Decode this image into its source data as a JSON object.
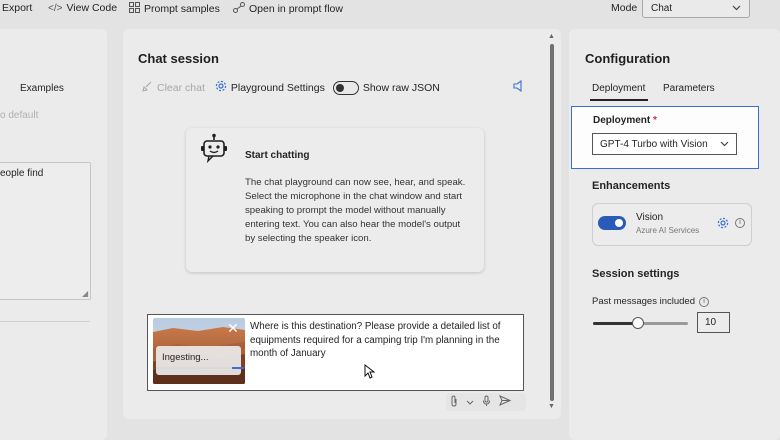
{
  "toolbar": {
    "export_label": "Export",
    "view_code_label": "View Code",
    "prompt_samples_label": "Prompt samples",
    "prompt_flow_label": "Open in prompt flow",
    "mode_label": "Mode",
    "mode_value": "Chat"
  },
  "left_panel": {
    "examples_label": "Examples",
    "default_text": "o default",
    "textarea_text": "eople find"
  },
  "chat": {
    "title": "Chat session",
    "clear_chat_label": "Clear chat",
    "playground_settings_label": "Playground Settings",
    "show_raw_json_label": "Show raw JSON",
    "start_title": "Start chatting",
    "start_body": "The chat playground can now see, hear, and speak. Select the microphone in the chat window and start speaking to prompt the model without manually entering text. You can also hear the model's output by selecting the speaker icon.",
    "ingesting_label": "Ingesting...",
    "prompt_text": "Where is this destination? Please provide a detailed list of equipments required for a camping trip I'm planning in the month of January",
    "ingest_progress": 0.14
  },
  "config": {
    "title": "Configuration",
    "tabs": [
      "Deployment",
      "Parameters"
    ],
    "deployment_label": "Deployment",
    "required_mark": "*",
    "deployment_value": "GPT-4 Turbo with Vision",
    "enhancements_title": "Enhancements",
    "vision_name": "Vision",
    "vision_sub": "Azure AI Services",
    "vision_enabled": true,
    "session_title": "Session settings",
    "past_messages_label": "Past messages included",
    "past_messages_value": "10"
  },
  "icons": {
    "export": "export-icon",
    "view_code": "code-icon",
    "prompt_samples": "grid-icon",
    "prompt_flow": "flow-icon",
    "clear_chat": "broom-icon",
    "settings": "gear-icon",
    "speaker": "speaker-icon",
    "bot": "bot-icon",
    "attach": "paperclip-icon",
    "mic": "microphone-icon",
    "send": "send-icon"
  },
  "colors": {
    "accent": "#3a6fd0",
    "toggle_on": "#2b5bb8",
    "required": "#c4314b"
  }
}
